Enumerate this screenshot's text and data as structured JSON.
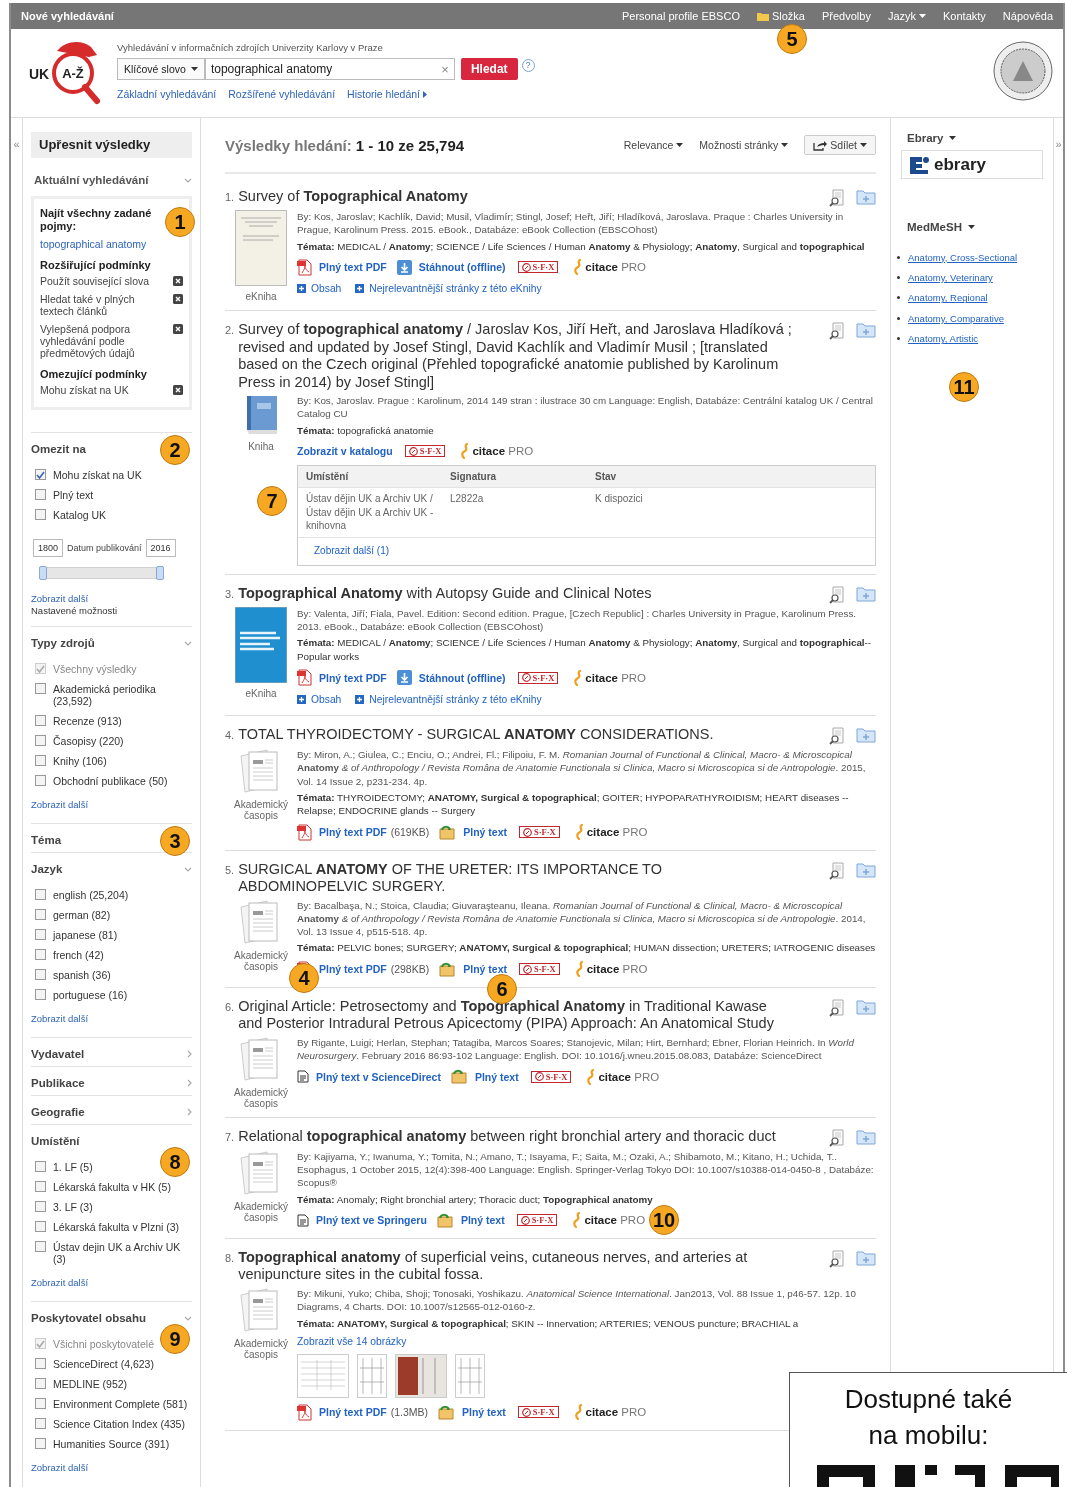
{
  "topbar": {
    "title": "Nové vyhledávání",
    "links": [
      {
        "label": "Personal profile EBSCO",
        "kind": "plain"
      },
      {
        "label": "Složka",
        "kind": "folder",
        "callout": "5"
      },
      {
        "label": "Předvolby",
        "kind": "plain"
      },
      {
        "label": "Jazyk",
        "kind": "menu"
      },
      {
        "label": "Kontakty",
        "kind": "plain"
      },
      {
        "label": "Nápověda",
        "kind": "plain"
      }
    ]
  },
  "header": {
    "logo": {
      "left": "UK",
      "center": "A-Ž"
    },
    "caption": "Vyhledávání v informačních zdrojích Univerzity Karlovy v Praze",
    "scope": "Klíčové slovo",
    "query": "topographical anatomy",
    "clear": "×",
    "search_button": "Hledat",
    "help": "?",
    "links": [
      {
        "label": "Základní vyhledávání",
        "kind": "plain"
      },
      {
        "label": "Rozšířené vyhledávání",
        "kind": "plain"
      },
      {
        "label": "Historie hledání",
        "kind": "arrow"
      }
    ]
  },
  "left": {
    "collapse": "«",
    "title": "Upřesnit výsledky",
    "current": {
      "heading": "Aktuální vyhledávání",
      "callout": "1",
      "find_all": "Najít všechny zadané pojmy:",
      "term": "topographical anatomy",
      "groups": [
        {
          "heading": "Rozšiřující podmínky",
          "items": [
            "Použít související slova",
            "Hledat také v plných textech článků",
            "Vylepšená podpora vyhledávání podle předmětových údajů"
          ]
        },
        {
          "heading": "Omezující podmínky",
          "items": [
            "Mohu získat na UK"
          ]
        }
      ]
    },
    "sections": [
      {
        "heading": "Omezit na",
        "kind": "plain",
        "callout": "2",
        "options": [
          {
            "label": "Mohu získat na UK",
            "checked": true,
            "disabled": false
          },
          {
            "label": "Plný text",
            "checked": false,
            "disabled": false
          },
          {
            "label": "Katalog UK",
            "checked": false,
            "disabled": false
          }
        ],
        "date": {
          "from": "1800",
          "label": "Datum publikování",
          "to": "2016",
          "level": 1
        },
        "more": "Zobrazit další",
        "note": "Nastavené možnosti"
      },
      {
        "heading": "Typy zdrojů",
        "kind": "open",
        "options": [
          {
            "label": "Všechny výsledky",
            "checked": true,
            "disabled": true
          },
          {
            "label": "Akademická periodika (23,592)",
            "checked": false,
            "disabled": false
          },
          {
            "label": "Recenze (913)",
            "checked": false,
            "disabled": false
          },
          {
            "label": "Časopisy (220)",
            "checked": false,
            "disabled": false
          },
          {
            "label": "Knihy (106)",
            "checked": false,
            "disabled": false
          },
          {
            "label": "Obchodní publikace (50)",
            "checked": false,
            "disabled": false
          }
        ],
        "more": "Zobrazit další"
      },
      {
        "heading": "Téma",
        "kind": "plain",
        "callout": "3"
      },
      {
        "heading": "Jazyk",
        "kind": "open",
        "options": [
          {
            "label": "english (25,204)",
            "checked": false,
            "disabled": false
          },
          {
            "label": "german (82)",
            "checked": false,
            "disabled": false
          },
          {
            "label": "japanese (81)",
            "checked": false,
            "disabled": false
          },
          {
            "label": "french (42)",
            "checked": false,
            "disabled": false
          },
          {
            "label": "spanish (36)",
            "checked": false,
            "disabled": false
          },
          {
            "label": "portuguese (16)",
            "checked": false,
            "disabled": false
          }
        ],
        "more": "Zobrazit další"
      },
      {
        "heading": "Vydavatel",
        "kind": "closed"
      },
      {
        "heading": "Publikace",
        "kind": "closed"
      },
      {
        "heading": "Geografie",
        "kind": "closed"
      },
      {
        "heading": "Umístění",
        "kind": "plain",
        "callout": "8",
        "options": [
          {
            "label": "1. LF (5)",
            "checked": false,
            "disabled": false
          },
          {
            "label": "Lékarská fakulta v HK (5)",
            "checked": false,
            "disabled": false
          },
          {
            "label": "3. LF (3)",
            "checked": false,
            "disabled": false
          },
          {
            "label": "Lékarská fakulta v Plzni (3)",
            "checked": false,
            "disabled": false
          },
          {
            "label": "Ústav dejin UK a Archiv UK (3)",
            "checked": false,
            "disabled": false
          }
        ],
        "more": "Zobrazit další"
      },
      {
        "heading": "Poskytovatel obsahu",
        "kind": "open",
        "callout": "9",
        "options": [
          {
            "label": "Všichni poskytovatelé",
            "checked": true,
            "disabled": true
          },
          {
            "label": "ScienceDirect (4,623)",
            "checked": false,
            "disabled": false
          },
          {
            "label": "MEDLINE (952)",
            "checked": false,
            "disabled": false
          },
          {
            "label": "Environment Complete (581)",
            "checked": false,
            "disabled": false
          },
          {
            "label": "Science Citation Index (435)",
            "checked": false,
            "disabled": false
          },
          {
            "label": "Humanities Source (391)",
            "checked": false,
            "disabled": false
          }
        ],
        "more": "Zobrazit další"
      }
    ]
  },
  "results_header": {
    "label": "Výsledky hledání:",
    "range": "1 - 10 ze 25,794",
    "controls": [
      {
        "label": "Relevance",
        "kind": "menu"
      },
      {
        "label": "Možnosti stránky",
        "kind": "menu"
      },
      {
        "label": "Sdílet",
        "kind": "share"
      }
    ]
  },
  "results": [
    {
      "number": "1.",
      "title": "Survey of **Topographical Anatomy**",
      "kind": "ebook",
      "type": "eKniha",
      "meta": "By: Kos, Jaroslav; Kachlík, David; Musil, Vladimír; Stingl, Josef; Heřt, Jiří; Hladíková, Jaroslava. Praque : Charles University in Prague, Karolinum Press. 2015. eBook., Databáze: eBook Collection (EBSCOhost)",
      "subjects": "**Témata:** MEDICAL / **Anatomy**; SCIENCE / Life Sciences / Human **Anatomy** & Physiology; **Anatomy**, Surgical and **topographical**",
      "links": [
        {
          "kind": "pdf",
          "label": "Plný text PDF"
        },
        {
          "kind": "download",
          "label": "Stáhnout (offline)"
        },
        {
          "kind": "sfx",
          "label": "S·F·X"
        },
        {
          "kind": "citace",
          "label": "**citace** PRO"
        }
      ],
      "extras": [
        "Obsah",
        "Nejrelevantnější stránky z této eKnihy"
      ]
    },
    {
      "number": "2.",
      "title": "Survey of **topographical anatomy** / Jaroslav Kos, Jiří Heřt, and Jaroslava Hladíková ; revised and updated by Josef Stingl, David Kachlík and Vladimír Musil ; [translated based on the Czech original (Přehled topografické anatomie published by Karolinum Press in 2014) by Josef Stingl]",
      "kind": "book",
      "type": "Kniha",
      "meta": "By: Kos, Jaroslav. Prague : Karolinum, 2014 149 stran : ilustrace 30 cm Language: English, Databáze: Centrální katalog UK / Central Catalog CU",
      "subjects": "**Témata:** topografická anatomie",
      "links": [
        {
          "kind": "catalog",
          "label": "Zobrazit v katalogu"
        },
        {
          "kind": "sfx",
          "label": "S·F·X"
        },
        {
          "kind": "citace",
          "label": "**citace** PRO"
        }
      ],
      "holdings": {
        "callout": "7",
        "columns": [
          "Umístění",
          "Signatura",
          "Stav"
        ],
        "rows": [
          [
            "Ústav dějin UK a Archiv UK / Ústav dějin UK a Archiv UK - knihovna",
            "L2822a",
            "K dispozici"
          ]
        ],
        "more": "Zobrazit další (1)"
      }
    },
    {
      "number": "3.",
      "title": "**Topographical Anatomy** with Autopsy Guide and Clinical Notes",
      "kind": "cover",
      "type": "eKniha",
      "meta": "By: Valenta, Jiří; Fiala, Pavel. Edition: Second edition. Prague, [Czech Republic] : Charles University in Prague, Karolinum Press. 2013. eBook., Databáze: eBook Collection (EBSCOhost)",
      "subjects": "**Témata:** MEDICAL / **Anatomy**; SCIENCE / Life Sciences / Human **Anatomy** & Physiology; **Anatomy**, Surgical and **topographical**--Popular works",
      "links": [
        {
          "kind": "pdf",
          "label": "Plný text PDF"
        },
        {
          "kind": "download",
          "label": "Stáhnout (offline)"
        },
        {
          "kind": "sfx",
          "label": "S·F·X"
        },
        {
          "kind": "citace",
          "label": "**citace** PRO"
        }
      ],
      "extras": [
        "Obsah",
        "Nejrelevantnější stránky z této eKnihy"
      ]
    },
    {
      "number": "4.",
      "title": "TOTAL THYROIDECTOMY - SURGICAL **ANATOMY** CONSIDERATIONS.",
      "kind": "article",
      "type": "Akademický časopis",
      "meta": "By: Miron, A.; Giulea, C.; Enciu, O.; Andrei, Fl.; Filipoiu, F. M. *Romanian Journal of Functional & Clinical, Macro- & Microscopical* **Anatomy** *& of Anthropology / Revista Româna de Anatomie Functionala si Clinica, Macro si Microscopica si de Antropologie*. 2015, Vol. 14 Issue 2, p231-234. 4p.",
      "subjects": "**Témata:** THYROIDECTOMY; **ANATOMY, Surgical & topographical**; GOITER; HYPOPARATHYROIDISM; HEART diseases -- Relapse; ENDOCRINE glands -- Surgery",
      "links": [
        {
          "kind": "pdf",
          "label": "Plný text PDF",
          "size": "(619KB)"
        },
        {
          "kind": "fulltext",
          "label": "Plný text"
        },
        {
          "kind": "sfx",
          "label": "S·F·X"
        },
        {
          "kind": "citace",
          "label": "**citace** PRO"
        }
      ]
    },
    {
      "number": "5.",
      "title": "SURGICAL **ANATOMY** OF THE URETER: ITS IMPORTANCE TO ABDOMINOPELVIC SURGERY.",
      "kind": "article",
      "type": "Akademický časopis",
      "type_callout": "4",
      "links_callout": "6",
      "meta": "By: Bacalbaşa, N.; Stoica, Claudia; Giuvaraşteanu, Ileana. *Romanian Journal of Functional & Clinical, Macro- & Microscopical* **Anatomy** *& of Anthropology / Revista Româna de Anatomie Functionala si Clinica, Macro si Microscopica si de Antropologie*. 2014, Vol. 13 Issue 4, p515-518. 4p.",
      "subjects": "**Témata:** PELVIC bones; SURGERY; **ANATOMY, Surgical & topographical**; HUMAN dissection; URETERS; IATROGENIC diseases",
      "links": [
        {
          "kind": "pdf",
          "label": "Plný text PDF",
          "size": "(298KB)"
        },
        {
          "kind": "fulltext",
          "label": "Plný text"
        },
        {
          "kind": "sfx",
          "label": "S·F·X"
        },
        {
          "kind": "citace",
          "label": "**citace** PRO"
        }
      ]
    },
    {
      "number": "6.",
      "title": "Original Article: Petrosectomy and **Topographical Anatomy** in Traditional Kawase and Posterior Intradural Petrous Apicectomy (PIPA) Approach: An Anatomical Study",
      "kind": "article",
      "type": "Akademický časopis",
      "meta": "By Rigante, Luigi; Herlan, Stephan; Tatagiba, Marcos Soares; Stanojevic, Milan; Hirt, Bernhard; Ebner, Florian Heinrich. In *World Neurosurgery*. February 2016 86:93-102 Language: English. DOI: 10.1016/j.wneu.2015.08.083, Databáze: ScienceDirect",
      "links": [
        {
          "kind": "external",
          "label": "Plný text v ScienceDirect"
        },
        {
          "kind": "fulltext",
          "label": "Plný text"
        },
        {
          "kind": "sfx",
          "label": "S·F·X"
        },
        {
          "kind": "citace",
          "label": "**citace** PRO"
        }
      ]
    },
    {
      "number": "7.",
      "title": "Relational **topographical anatomy** between right bronchial artery and thoracic duct",
      "kind": "article",
      "type": "Akademický časopis",
      "links_callout": "10",
      "meta": "By: Kajiyama, Y.; Iwanuma, Y.; Tomita, N.; Amano, T.; Isayama, F.; Saita, M.; Ozaki, A.; Shibamoto, M.; Kitano, H.; Uchida, T.. Esophagus, 1 October 2015, 12(4):398-400 Language: English. Springer-Verlag Tokyo DOI: 10.1007/s10388-014-0450-8 , Databáze: Scopus®",
      "subjects": "**Témata:** Anomaly; Right bronchial artery; Thoracic duct; **Topographical anatomy**",
      "links": [
        {
          "kind": "external",
          "label": "Plný text ve Springeru"
        },
        {
          "kind": "fulltext",
          "label": "Plný text"
        },
        {
          "kind": "sfx",
          "label": "S·F·X"
        },
        {
          "kind": "citace",
          "label": "**citace** PRO"
        }
      ]
    },
    {
      "number": "8.",
      "title": "**Topographical anatomy** of superficial veins, cutaneous nerves, and arteries at venipuncture sites in the cubital fossa.",
      "kind": "article",
      "type": "Akademický časopis",
      "meta": "By: Mikuni, Yuko; Chiba, Shoji; Tonosaki, Yoshikazu. *Anatomical Science International*. Jan2013, Vol. 88 Issue 1, p46-57. 12p. 10 Diagrams, 4 Charts. DOI: 10.1007/s12565-012-0160-z.",
      "subjects": "**Témata: ANATOMY, Surgical & topographical**; SKIN -- Innervation; ARTERIES; VENOUS puncture; BRACHIAL a",
      "images": {
        "more": "Zobrazit vše 14 obrázky",
        "items": [
          {
            "kind": "table"
          },
          {
            "kind": "diagram"
          },
          {
            "kind": "photo"
          },
          {
            "kind": "diagram"
          }
        ]
      },
      "links": [
        {
          "kind": "pdf",
          "label": "Plný text PDF",
          "size": "(1.3MB)"
        },
        {
          "kind": "fulltext",
          "label": "Plný text"
        },
        {
          "kind": "sfx",
          "label": "S·F·X"
        },
        {
          "kind": "citace",
          "label": "**citace** PRO"
        }
      ]
    }
  ],
  "right": {
    "expand": "»",
    "heading": "Ebrary",
    "logo": "ebrary",
    "mesh_heading": "MedMeSH",
    "mesh_links": [
      "Anatomy, Cross-Sectional",
      "Anatomy, Veterinary",
      "Anatomy, Regional",
      "Anatomy, Comparative",
      "Anatomy, Artistic"
    ],
    "callout": "11"
  },
  "mobile": {
    "text": "Dostupné také na mobilu:"
  }
}
